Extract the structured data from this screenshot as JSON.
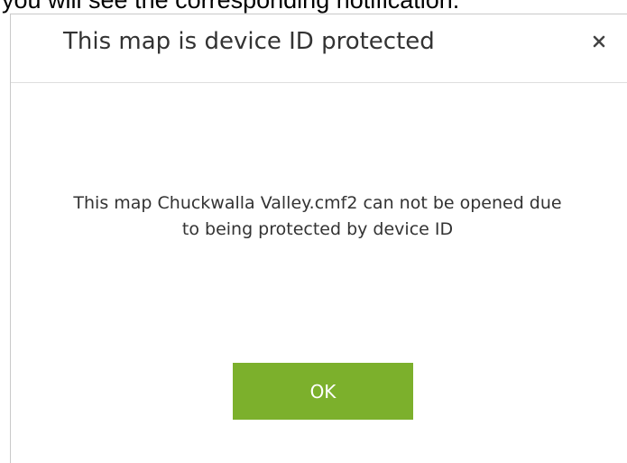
{
  "background": {
    "caption": "you will see the corresponding notification."
  },
  "dialog": {
    "title": "This map is device ID protected",
    "close_icon": "close-icon",
    "message": "This map Chuckwalla Valley.cmf2 can not be opened due to being protected by device ID",
    "ok_label": "OK"
  },
  "colors": {
    "accent": "#7cb02c",
    "text": "#333333",
    "border": "#c9c9c9"
  }
}
